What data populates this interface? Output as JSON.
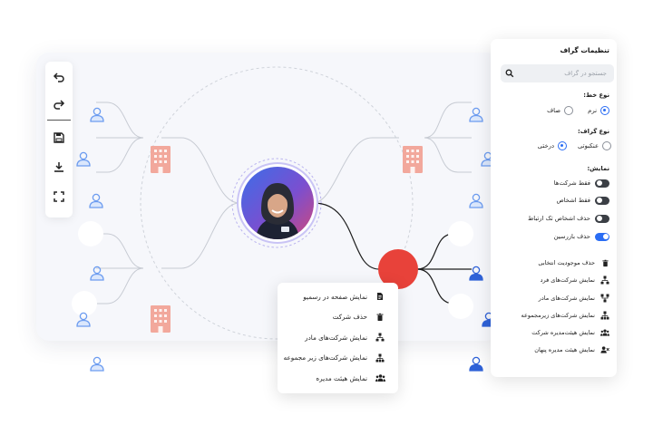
{
  "colors": {
    "accent": "#2a6df4",
    "node_red": "#e8423a",
    "building": "#f2a89c",
    "person": "#6c9cf0",
    "person_dark": "#2f62d8",
    "line_dark": "#1e1e1e",
    "line_light": "#c7cbd3"
  },
  "toolbar": {
    "items": [
      {
        "name": "undo-icon"
      },
      {
        "name": "redo-icon"
      },
      {
        "name": "save-icon"
      },
      {
        "name": "download-icon"
      },
      {
        "name": "fullscreen-icon"
      }
    ]
  },
  "context_menu": {
    "items": [
      {
        "label": "نمایش صفحه در رسمیو",
        "icon": "document-icon"
      },
      {
        "label": "حذف شرکت",
        "icon": "trash-icon"
      },
      {
        "label": "نمایش شرکت‌های مادر",
        "icon": "hierarchy-up-icon"
      },
      {
        "label": "نمایش شرکت‌های زیر مجموعه",
        "icon": "hierarchy-down-icon"
      },
      {
        "label": "نمایش هیئت مدیره",
        "icon": "people-icon"
      }
    ]
  },
  "panel": {
    "title": "تنظیمات گراف",
    "search_placeholder": "جستجو در گراف",
    "line_type": {
      "label": "نوع خط:",
      "options": [
        {
          "label": "نرم",
          "selected": true
        },
        {
          "label": "صاف",
          "selected": false
        }
      ]
    },
    "graph_type": {
      "label": "نوع گراف:",
      "options": [
        {
          "label": "درختی",
          "selected": true
        },
        {
          "label": "عنکبوتی",
          "selected": false
        }
      ]
    },
    "display": {
      "label": "نمایش:",
      "toggles": [
        {
          "label": "فقط شرکت‌ها",
          "on": false
        },
        {
          "label": "فقط اشخاص",
          "on": false
        },
        {
          "label": "حذف اشخاص تک ارتباط",
          "on": false
        },
        {
          "label": "حذف بازرسین",
          "on": true
        }
      ]
    },
    "actions": [
      {
        "label": "حذف موجودیت انتخابی",
        "icon": "trash-icon"
      },
      {
        "label": "نمایش شرکت‌های فرد",
        "icon": "hierarchy-icon"
      },
      {
        "label": "نمایش شرکت‌های مادر",
        "icon": "hierarchy-up-icon"
      },
      {
        "label": "نمایش شرکت‌های زیرمجموعه",
        "icon": "hierarchy-down-icon"
      },
      {
        "label": "نمایش هیئت‌مدیره شرکت",
        "icon": "people-icon"
      },
      {
        "label": "نمایش هیئت مدیره پنهان",
        "icon": "people-hidden-icon"
      }
    ]
  }
}
